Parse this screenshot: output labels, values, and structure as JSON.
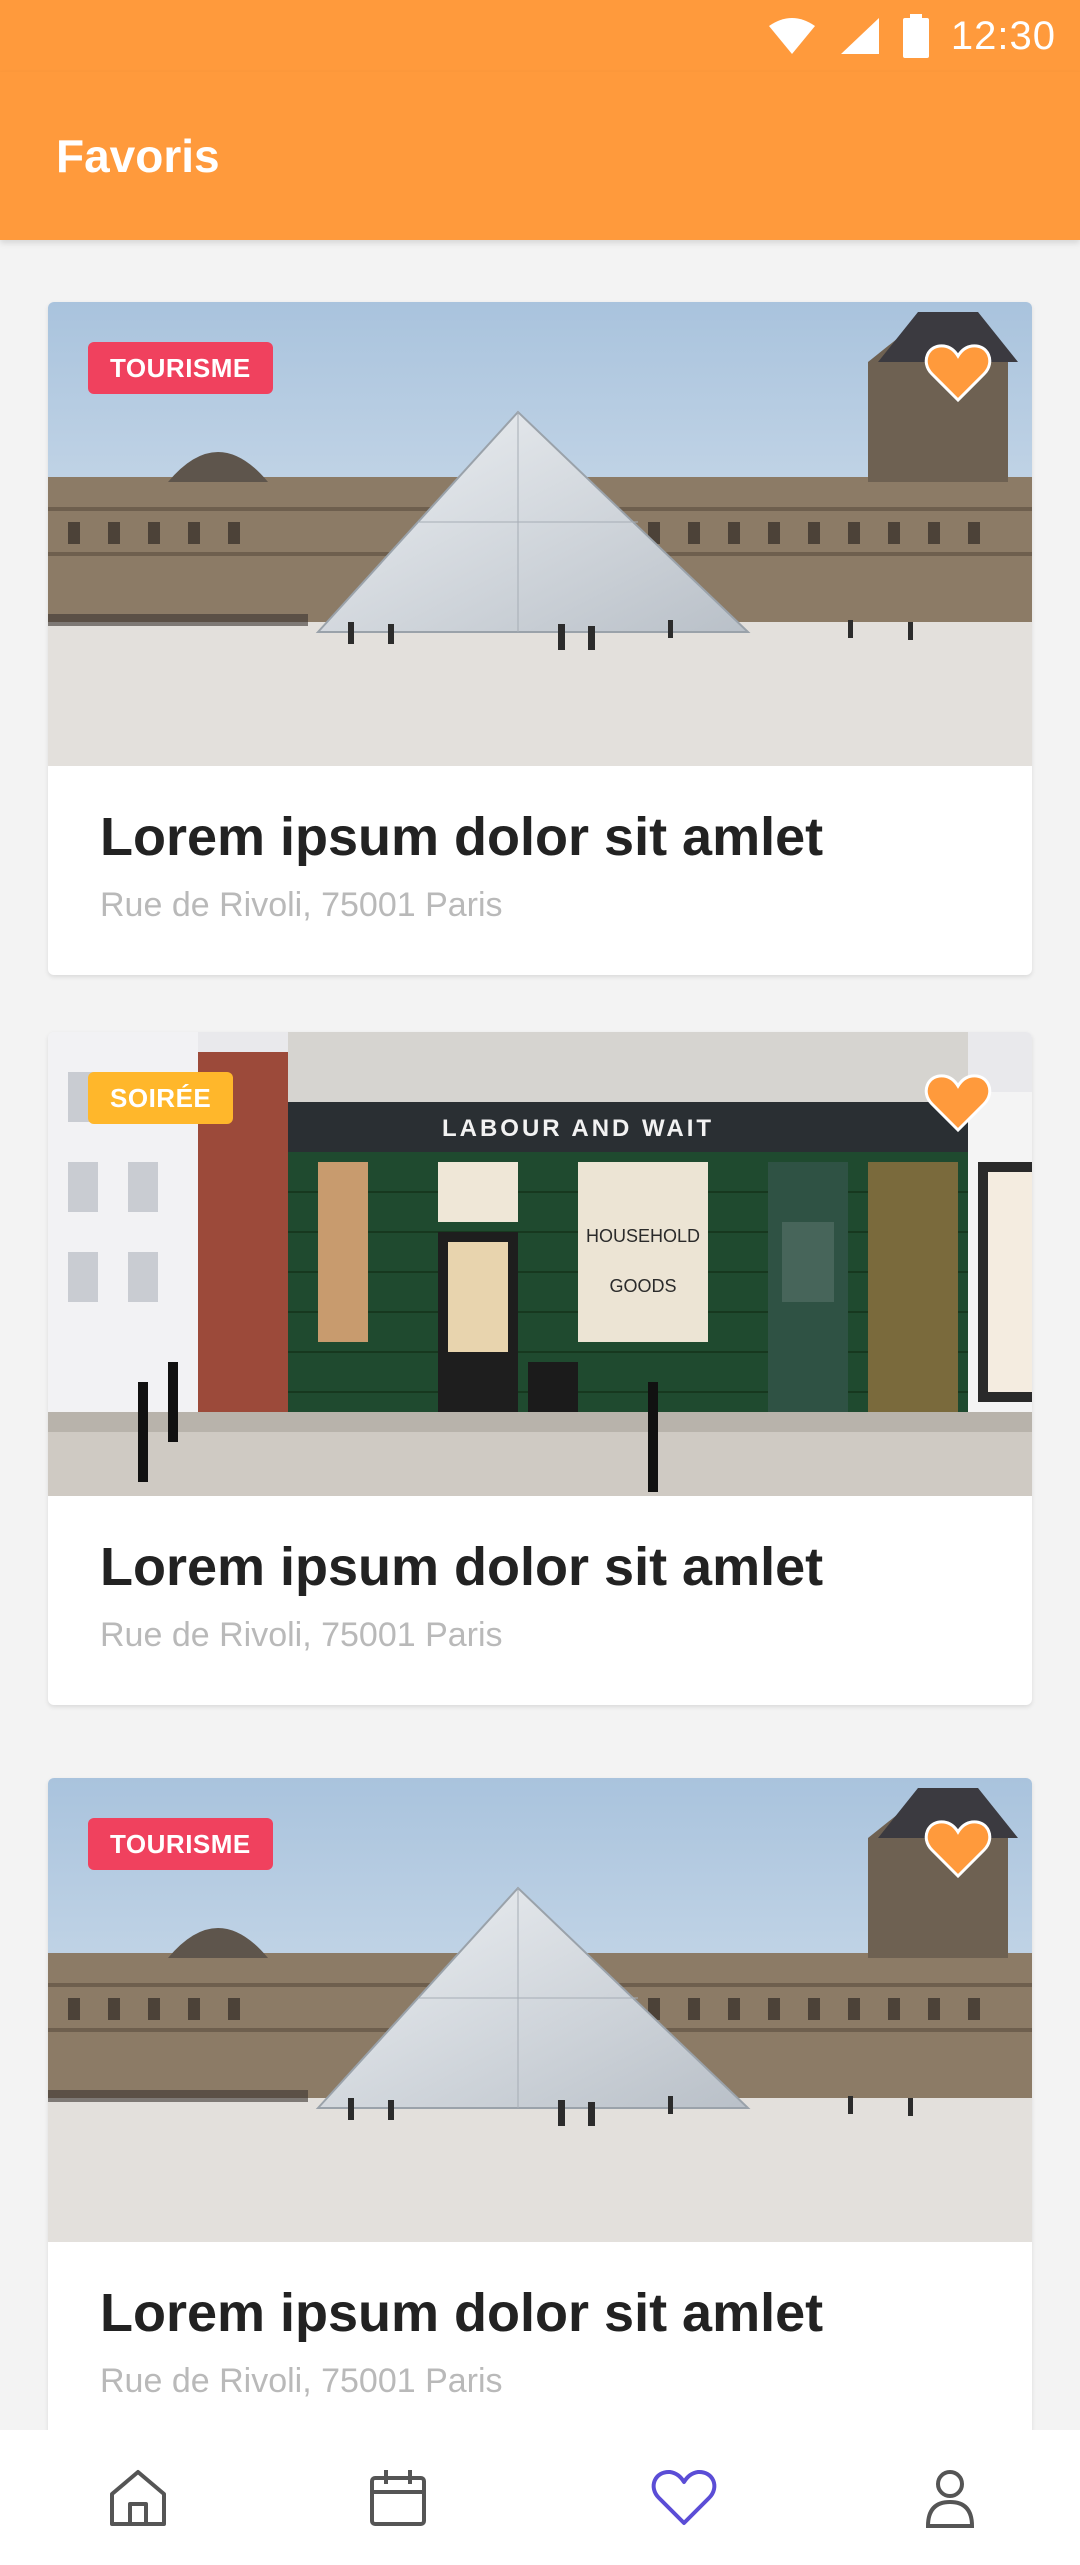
{
  "status_bar": {
    "time": "12:30",
    "icons": [
      "wifi-icon",
      "cellular-signal-icon",
      "battery-icon"
    ],
    "color": "#ff9a3c"
  },
  "app_bar": {
    "title": "Favoris"
  },
  "cards": [
    {
      "tag": "TOURISME",
      "tag_color": "#f0415e",
      "image": "louvre-pyramid-photo",
      "favorited": true,
      "title": "Lorem ipsum dolor sit amlet",
      "address": "Rue de Rivoli, 75001 Paris"
    },
    {
      "tag": "SOIRÉE",
      "tag_color": "#ffb72b",
      "image": "shopfront-photo",
      "shop_sign": "LABOUR AND WAIT",
      "window_text": [
        "HOUSEHOLD",
        "GOODS"
      ],
      "favorited": true,
      "title": "Lorem ipsum dolor sit amlet",
      "address": "Rue de Rivoli, 75001 Paris"
    },
    {
      "tag": "TOURISME",
      "tag_color": "#f0415e",
      "image": "louvre-pyramid-photo",
      "favorited": true,
      "title": "Lorem ipsum dolor sit amlet",
      "address": "Rue de Rivoli, 75001 Paris"
    }
  ],
  "bottom_nav": {
    "items": [
      {
        "icon": "home-icon",
        "active": false
      },
      {
        "icon": "calendar-icon",
        "active": false
      },
      {
        "icon": "heart-icon",
        "active": true
      },
      {
        "icon": "profile-icon",
        "active": false
      }
    ],
    "active_color": "#5b4dd6",
    "inactive_color": "#555555"
  },
  "colors": {
    "accent": "#ff9a3c",
    "favorite": "#ff9a3c"
  }
}
